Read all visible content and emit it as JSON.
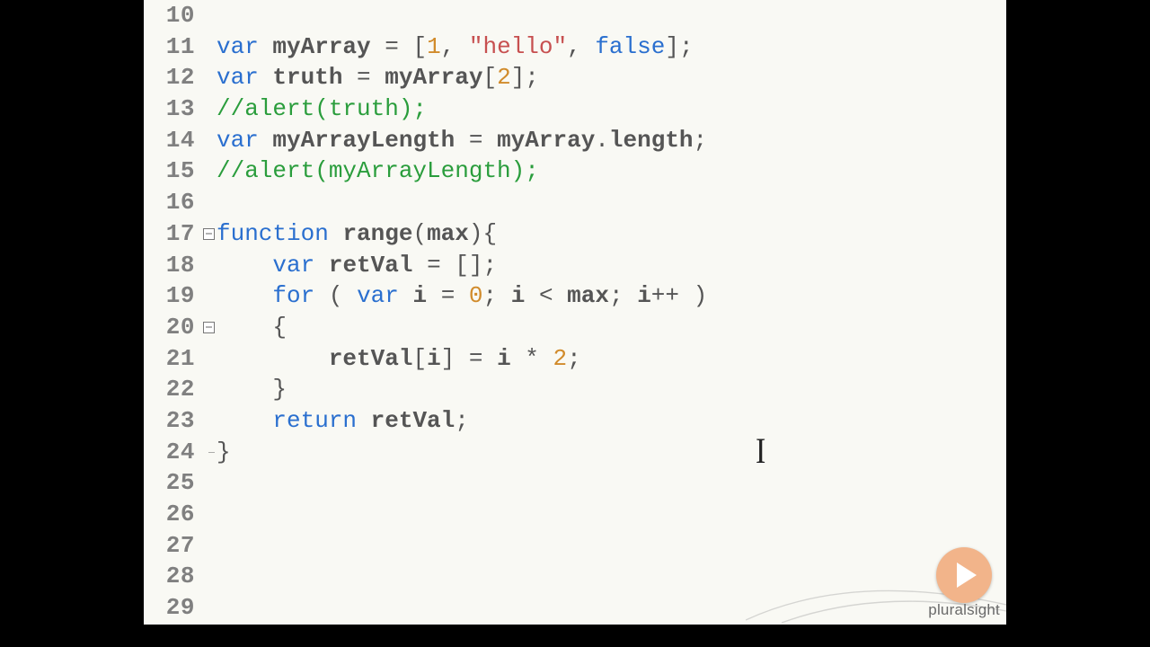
{
  "brand": "pluralsight",
  "gutter": [
    "10",
    "11",
    "12",
    "13",
    "14",
    "15",
    "16",
    "17",
    "18",
    "19",
    "20",
    "21",
    "22",
    "23",
    "24",
    "25",
    "26",
    "27",
    "28",
    "29"
  ],
  "fold": {
    "17": "box",
    "18": "guide",
    "19": "guide",
    "20": "box",
    "21": "guide",
    "22": "guide",
    "23": "guide",
    "24": "end"
  },
  "code": {
    "10": [],
    "11": [
      {
        "t": "kw",
        "v": "var "
      },
      {
        "t": "id",
        "v": "myArray"
      },
      {
        "t": "op",
        "v": " = "
      },
      {
        "t": "punct",
        "v": "["
      },
      {
        "t": "num",
        "v": "1"
      },
      {
        "t": "punct",
        "v": ", "
      },
      {
        "t": "str",
        "v": "\"hello\""
      },
      {
        "t": "punct",
        "v": ", "
      },
      {
        "t": "bool",
        "v": "false"
      },
      {
        "t": "punct",
        "v": "];"
      }
    ],
    "12": [
      {
        "t": "kw",
        "v": "var "
      },
      {
        "t": "id",
        "v": "truth"
      },
      {
        "t": "op",
        "v": " = "
      },
      {
        "t": "id",
        "v": "myArray"
      },
      {
        "t": "punct",
        "v": "["
      },
      {
        "t": "num",
        "v": "2"
      },
      {
        "t": "punct",
        "v": "];"
      }
    ],
    "13": [
      {
        "t": "cmt",
        "v": "//alert(truth);"
      }
    ],
    "14": [
      {
        "t": "kw",
        "v": "var "
      },
      {
        "t": "id",
        "v": "myArrayLength"
      },
      {
        "t": "op",
        "v": " = "
      },
      {
        "t": "id",
        "v": "myArray"
      },
      {
        "t": "punct",
        "v": "."
      },
      {
        "t": "id",
        "v": "length"
      },
      {
        "t": "punct",
        "v": ";"
      }
    ],
    "15": [
      {
        "t": "cmt",
        "v": "//alert(myArrayLength);"
      }
    ],
    "16": [],
    "17": [
      {
        "t": "kw",
        "v": "function "
      },
      {
        "t": "id",
        "v": "range"
      },
      {
        "t": "punct",
        "v": "("
      },
      {
        "t": "id",
        "v": "max"
      },
      {
        "t": "punct",
        "v": "){"
      }
    ],
    "18": [
      {
        "t": "indent",
        "v": "    "
      },
      {
        "t": "kw",
        "v": "var "
      },
      {
        "t": "id",
        "v": "retVal"
      },
      {
        "t": "op",
        "v": " = "
      },
      {
        "t": "punct",
        "v": "[];"
      }
    ],
    "19": [
      {
        "t": "indent",
        "v": "    "
      },
      {
        "t": "kw",
        "v": "for "
      },
      {
        "t": "punct",
        "v": "( "
      },
      {
        "t": "kw",
        "v": "var "
      },
      {
        "t": "id",
        "v": "i"
      },
      {
        "t": "op",
        "v": " = "
      },
      {
        "t": "num",
        "v": "0"
      },
      {
        "t": "punct",
        "v": "; "
      },
      {
        "t": "id",
        "v": "i"
      },
      {
        "t": "op",
        "v": " < "
      },
      {
        "t": "id",
        "v": "max"
      },
      {
        "t": "punct",
        "v": "; "
      },
      {
        "t": "id",
        "v": "i"
      },
      {
        "t": "op",
        "v": "++"
      },
      {
        "t": "punct",
        "v": " )"
      }
    ],
    "20": [
      {
        "t": "indent",
        "v": "    "
      },
      {
        "t": "punct",
        "v": "{"
      }
    ],
    "21": [
      {
        "t": "indent",
        "v": "        "
      },
      {
        "t": "id",
        "v": "retVal"
      },
      {
        "t": "punct",
        "v": "["
      },
      {
        "t": "id",
        "v": "i"
      },
      {
        "t": "punct",
        "v": "]"
      },
      {
        "t": "op",
        "v": " = "
      },
      {
        "t": "id",
        "v": "i"
      },
      {
        "t": "op",
        "v": " * "
      },
      {
        "t": "num",
        "v": "2"
      },
      {
        "t": "punct",
        "v": ";"
      }
    ],
    "22": [
      {
        "t": "indent",
        "v": "    "
      },
      {
        "t": "punct",
        "v": "}"
      }
    ],
    "23": [
      {
        "t": "indent",
        "v": "    "
      },
      {
        "t": "kw",
        "v": "return "
      },
      {
        "t": "id",
        "v": "retVal"
      },
      {
        "t": "punct",
        "v": ";"
      }
    ],
    "24": [
      {
        "t": "punct",
        "v": "}"
      }
    ],
    "25": [],
    "26": [],
    "27": [],
    "28": [],
    "29": []
  },
  "base_indent": "    "
}
